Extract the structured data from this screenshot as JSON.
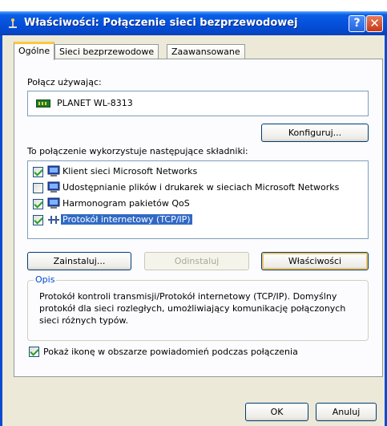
{
  "window": {
    "title": "Właściwości: Połączenie sieci bezprzewodowej",
    "help_glyph": "?",
    "close_glyph": "✕"
  },
  "tabs": [
    {
      "label": "Ogólne",
      "active": true
    },
    {
      "label": "Sieci bezprzewodowe",
      "active": false
    },
    {
      "label": "Zaawansowane",
      "active": false
    }
  ],
  "general": {
    "connect_using_label": "Połącz używając:",
    "device_name": "PLANET WL-8313",
    "configure_button": "Konfiguruj...",
    "components_label": "To połączenie wykorzystuje następujące składniki:",
    "components": [
      {
        "label": "Klient sieci Microsoft Networks",
        "checked": true,
        "icon": "network-client-icon"
      },
      {
        "label": "Udostępnianie plików i drukarek w sieciach Microsoft Networks",
        "checked": false,
        "icon": "file-printer-sharing-icon"
      },
      {
        "label": "Harmonogram pakietów QoS",
        "checked": true,
        "icon": "qos-scheduler-icon"
      },
      {
        "label": "Protokół internetowy (TCP/IP)",
        "checked": true,
        "icon": "protocol-icon",
        "selected": true
      }
    ],
    "install_button": "Zainstaluj...",
    "uninstall_button": "Odinstaluj",
    "properties_button": "Właściwości",
    "description_title": "Opis",
    "description_text": "Protokół kontroli transmisji/Protokół internetowy (TCP/IP). Domyślny protokół dla sieci rozległych, umożliwiający komunikację połączonych sieci różnych typów.",
    "notify_label": "Pokaż ikonę w obszarze powiadomień podczas połączenia",
    "notify_checked": true
  },
  "footer": {
    "ok_button": "OK",
    "cancel_button": "Anuluj"
  }
}
